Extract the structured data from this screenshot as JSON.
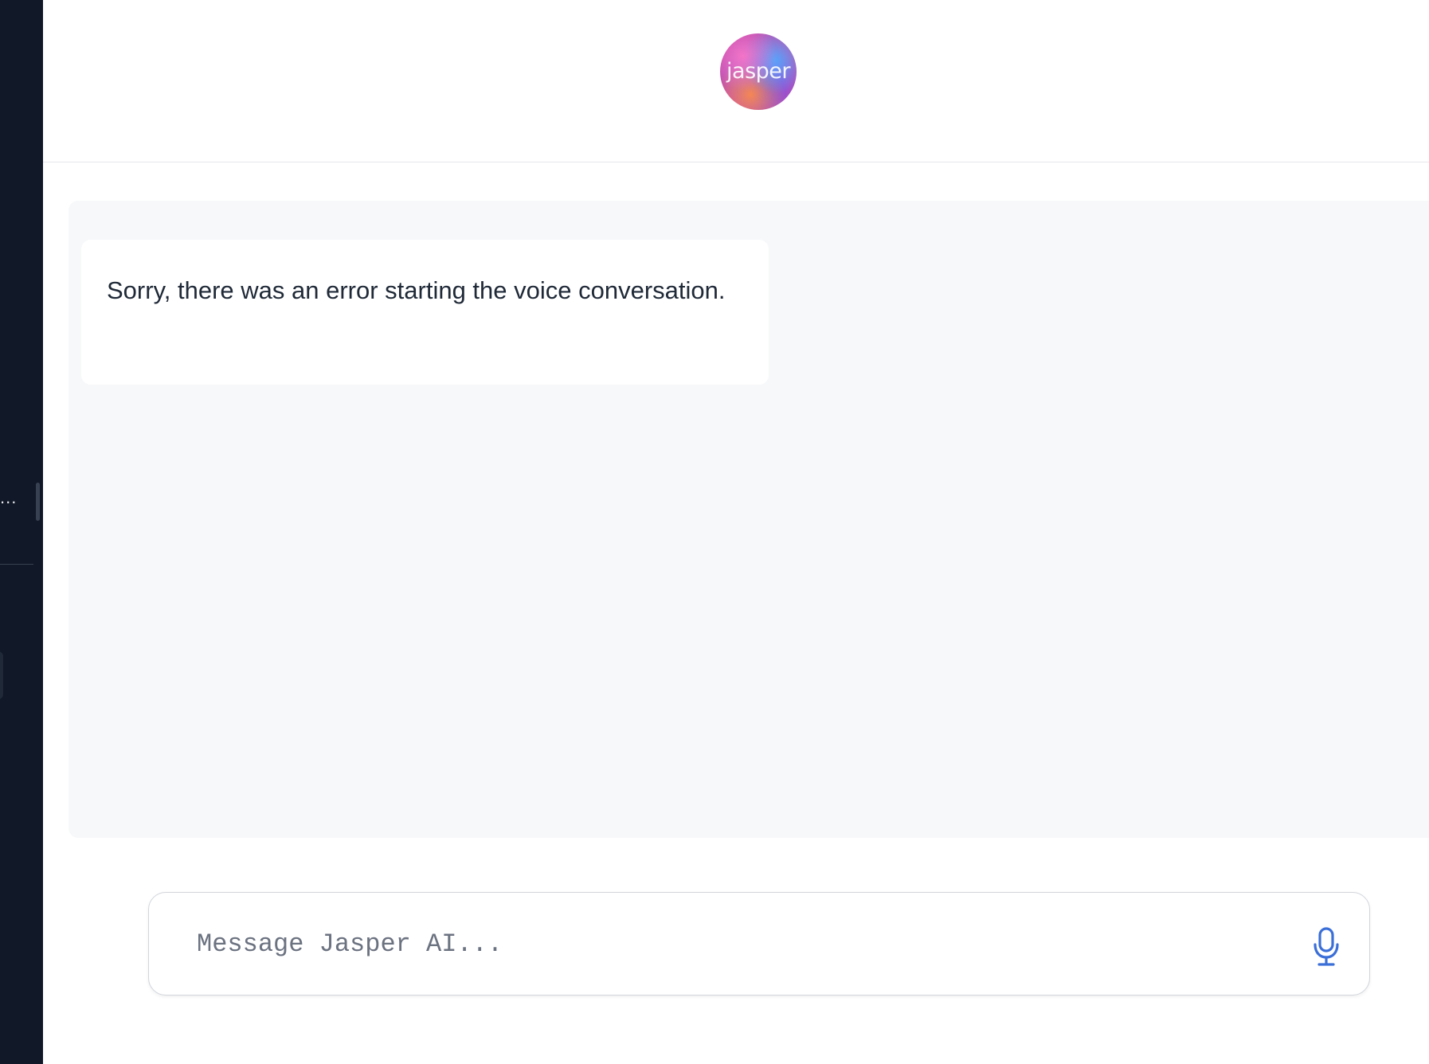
{
  "sidebar": {
    "truncated_label": "..."
  },
  "header": {
    "logo_text": "jasper"
  },
  "chat": {
    "messages": [
      {
        "role": "assistant",
        "text": "Sorry, there was an error starting the voice conversation."
      }
    ]
  },
  "composer": {
    "placeholder": "Message Jasper AI...",
    "value": "",
    "mic_icon": "microphone-icon",
    "accent_color": "#3b6fd8"
  },
  "colors": {
    "sidebar_bg": "#111827",
    "chat_bg": "#f7f8fa"
  }
}
